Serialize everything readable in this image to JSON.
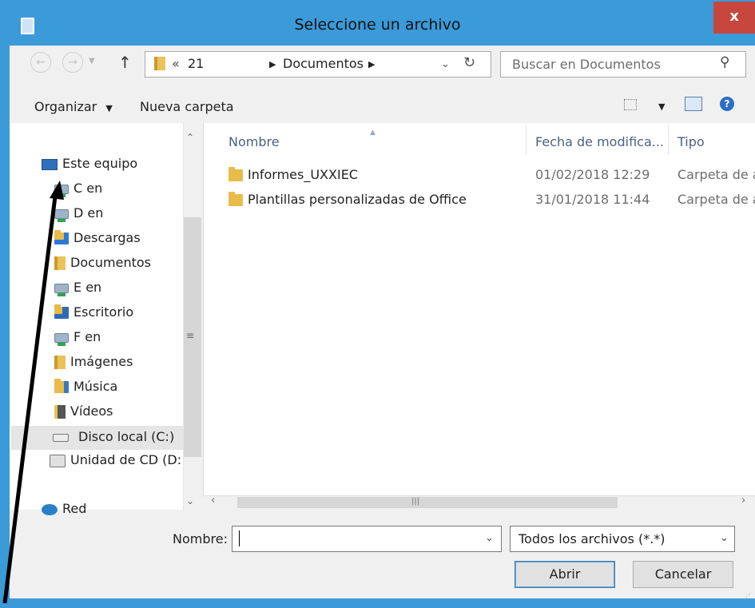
{
  "window": {
    "title": "Seleccione un archivo",
    "close_label": "x"
  },
  "nav": {
    "back_icon": "back-icon",
    "forward_icon": "forward-icon",
    "breadcrumb": [
      "21",
      "Documentos"
    ],
    "breadcrumb_overflow": "«",
    "search_placeholder": "Buscar en Documentos"
  },
  "toolbar": {
    "organize_label": "Organizar",
    "new_folder_label": "Nueva carpeta"
  },
  "sidebar": {
    "items": [
      {
        "label": "Este equipo",
        "icon": "computer-icon"
      },
      {
        "label": "C en",
        "icon": "network-drive-icon"
      },
      {
        "label": "D en",
        "icon": "network-drive-icon"
      },
      {
        "label": "Descargas",
        "icon": "downloads-folder-icon"
      },
      {
        "label": "Documentos",
        "icon": "documents-folder-icon"
      },
      {
        "label": "E en",
        "icon": "network-drive-icon"
      },
      {
        "label": "Escritorio",
        "icon": "desktop-folder-icon"
      },
      {
        "label": "F en",
        "icon": "network-drive-icon"
      },
      {
        "label": "Imágenes",
        "icon": "pictures-folder-icon"
      },
      {
        "label": "Música",
        "icon": "music-folder-icon"
      },
      {
        "label": "Vídeos",
        "icon": "videos-folder-icon"
      },
      {
        "label": "Disco local (C:)",
        "icon": "hard-drive-icon"
      },
      {
        "label": "Unidad de CD (D:",
        "icon": "cd-drive-icon"
      },
      {
        "label": "Red",
        "icon": "network-icon"
      }
    ]
  },
  "files": {
    "columns": [
      "Nombre",
      "Fecha de modifica...",
      "Tipo"
    ],
    "rows": [
      {
        "name": "Informes_UXXIEC",
        "date": "01/02/2018 12:29",
        "type": "Carpeta de a"
      },
      {
        "name": "Plantillas personalizadas de Office",
        "date": "31/01/2018 11:44",
        "type": "Carpeta de a"
      }
    ]
  },
  "bottom": {
    "name_label": "Nombre:",
    "name_value": "",
    "filter_value": "Todos los archivos (*.*)",
    "open_label": "Abrir",
    "cancel_label": "Cancelar"
  },
  "colors": {
    "frame": "#3b9ad8",
    "close": "#c7463d",
    "header_text": "#4d6185"
  }
}
